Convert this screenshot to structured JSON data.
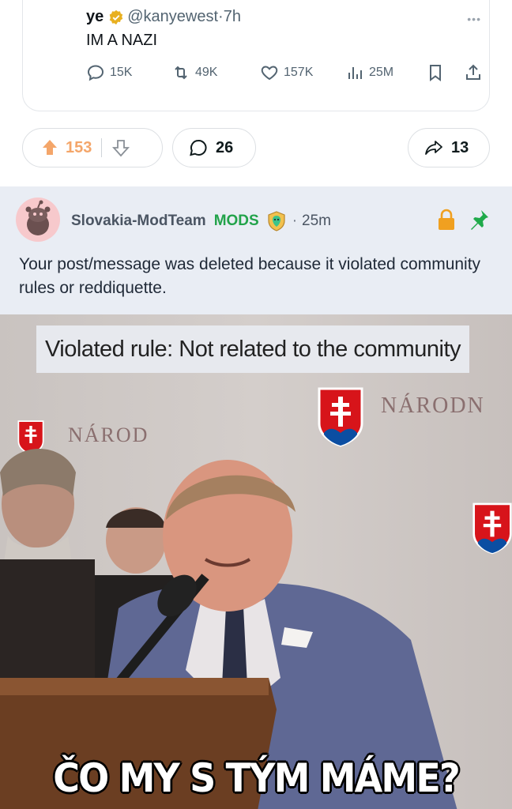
{
  "tweet": {
    "name": "ye",
    "handle": "@kanyewest",
    "time": "7h",
    "text": "IM A NAZI",
    "replies": "15K",
    "retweets": "49K",
    "likes": "157K",
    "views": "25M",
    "more_icon": "more-horizontal-icon"
  },
  "actions": {
    "upvotes": "153",
    "comments": "26",
    "shares": "13"
  },
  "mod_comment": {
    "username": "Slovakia-ModTeam",
    "badge": "MODS",
    "separator": "·",
    "age": "25m",
    "body": "Your post/message was deleted because it violated community rules or reddiquette."
  },
  "meme": {
    "caption_box": "Violated rule: Not related to the community",
    "caption_bottom": "ČO MY S TÝM MÁME?"
  },
  "colors": {
    "upvote": "#f4a66a",
    "mod_green": "#22a34a",
    "lock_orange": "#f0a020",
    "pin_green": "#1faa4a",
    "mod_bg": "#e9edf4"
  }
}
